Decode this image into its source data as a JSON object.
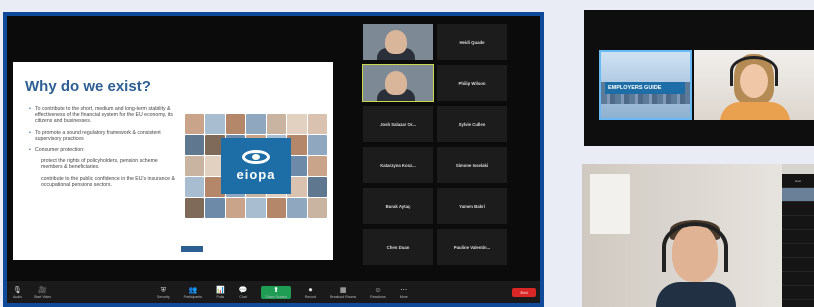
{
  "main_meeting": {
    "slide": {
      "title": "Why do we exist?",
      "bullets": [
        "To contribute to the short, medium and long-term stability & effectiveness of the financial system for the EU economy, its citizens and businesses.",
        "To promote a sound regulatory framework & consistent supervisory practices",
        "Consumer protection:"
      ],
      "sub_bullets": [
        "protect the rights of policyholders, pension scheme members & beneficiaries.",
        "contribute to the public confidence in the EU's insurance & occupational pensions sectors."
      ],
      "logo_text": "eiopa"
    },
    "participants": [
      {
        "name": "",
        "video": true
      },
      {
        "name": "Heidi Quade"
      },
      {
        "name": "",
        "video": true,
        "active": true
      },
      {
        "name": "Philip Wilson"
      },
      {
        "name": "Josh Salazar Or..."
      },
      {
        "name": "Sylvie Cullen"
      },
      {
        "name": "Katarzyna Kosz..."
      },
      {
        "name": "Simone Isselaki"
      },
      {
        "name": "Burak Aytaç"
      },
      {
        "name": "Yamen Bakri"
      },
      {
        "name": "Chen Duan"
      },
      {
        "name": "Pauline Valentin..."
      }
    ],
    "toolbar": {
      "left": [
        {
          "icon": "mic-icon",
          "glyph": "🎙",
          "label": "Audio"
        },
        {
          "icon": "camera-icon",
          "glyph": "🎥",
          "label": "Start Video"
        }
      ],
      "center": [
        {
          "icon": "shield-icon",
          "glyph": "⛨",
          "label": "Security"
        },
        {
          "icon": "participants-icon",
          "glyph": "👥",
          "label": "Participants"
        },
        {
          "icon": "poll-icon",
          "glyph": "📊",
          "label": "Polls"
        },
        {
          "icon": "chat-icon",
          "glyph": "💬",
          "label": "Chat"
        },
        {
          "icon": "share-icon",
          "glyph": "⬆",
          "label": "Share Screen",
          "highlight": true
        },
        {
          "icon": "record-icon",
          "glyph": "⏺",
          "label": "Record"
        },
        {
          "icon": "rooms-icon",
          "glyph": "▦",
          "label": "Breakout Rooms"
        },
        {
          "icon": "reactions-icon",
          "glyph": "☺",
          "label": "Reactions"
        },
        {
          "icon": "more-icon",
          "glyph": "⋯",
          "label": "More"
        }
      ],
      "end_label": "End"
    }
  },
  "top_right": {
    "banner_text": "EMPLOYERS GUIDE"
  },
  "bottom_right": {
    "panel_rows": [
      {
        "name": "Host",
        "video": false
      },
      {
        "name": "",
        "video": true
      },
      {
        "name": "",
        "video": false
      },
      {
        "name": "",
        "video": false
      },
      {
        "name": "",
        "video": false
      },
      {
        "name": "",
        "video": false
      },
      {
        "name": "",
        "video": false
      },
      {
        "name": "",
        "video": false
      },
      {
        "name": "",
        "video": false
      }
    ]
  }
}
